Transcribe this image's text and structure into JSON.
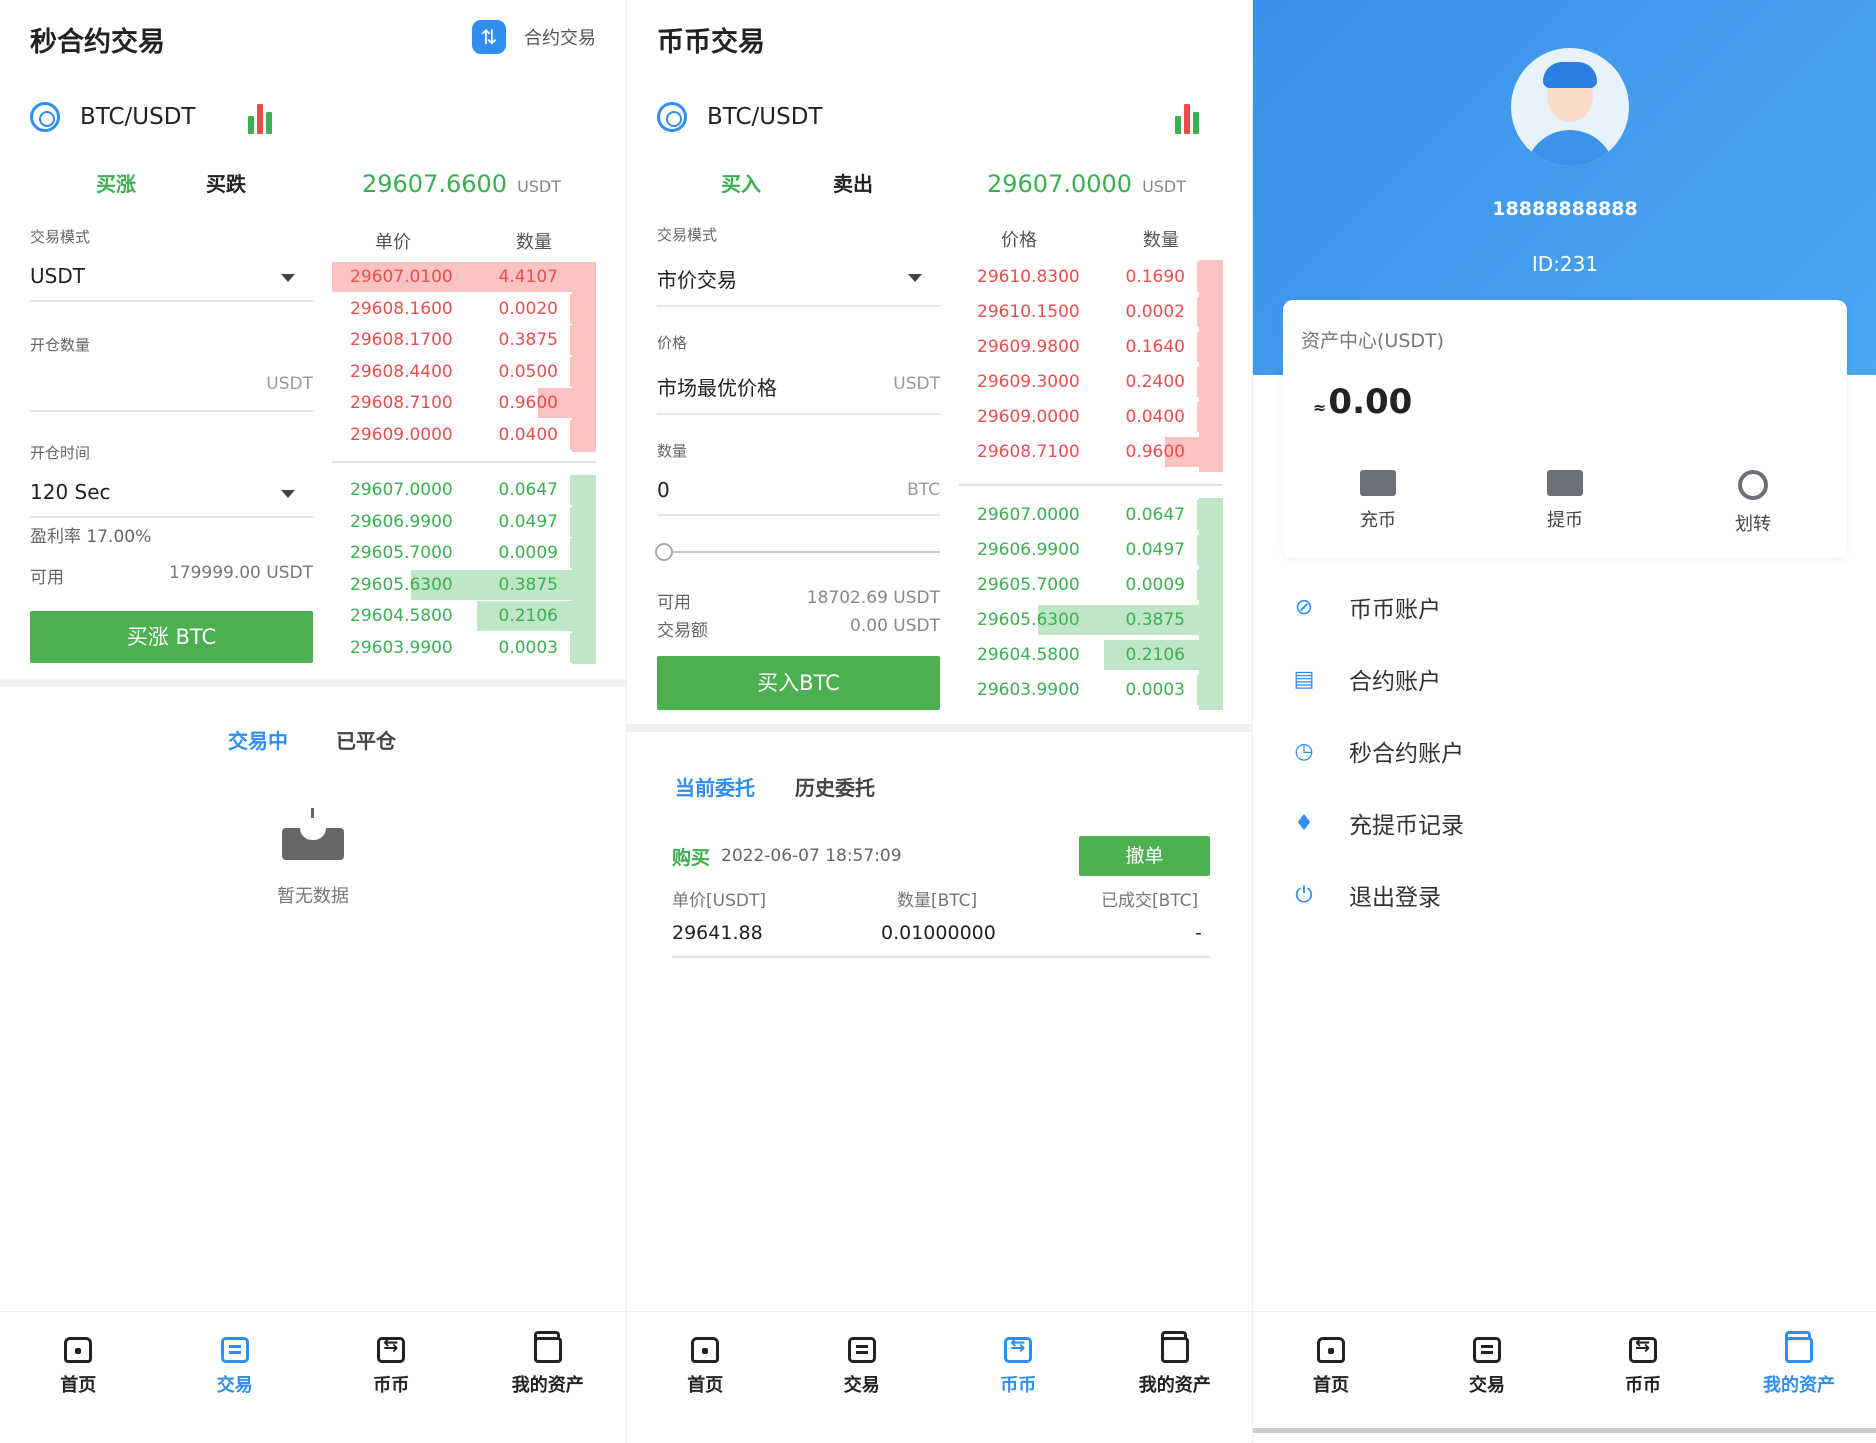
{
  "p1": {
    "title": "秒合约交易",
    "contract_link": "合约交易",
    "pair": "BTC/USDT",
    "tab_buy_up": "买涨",
    "tab_buy_down": "买跌",
    "last_price": "29607.6600",
    "last_price_unit": "USDT",
    "mode_label": "交易模式",
    "mode_value": "USDT",
    "qty_label": "开仓数量",
    "qty_unit": "USDT",
    "time_label": "开仓时间",
    "time_value": "120 Sec",
    "profit_rate": "盈利率 17.00%",
    "avail_label": "可用",
    "avail_value": "179999.00",
    "avail_unit": "USDT",
    "submit": "买涨 BTC",
    "ob_head_price": "单价",
    "ob_head_qty": "数量",
    "sells": [
      {
        "p": "29607.0100",
        "q": "4.4107",
        "fill": 1.0
      },
      {
        "p": "29608.1600",
        "q": "0.0020",
        "fill": 0.1
      },
      {
        "p": "29608.1700",
        "q": "0.3875",
        "fill": 0.1
      },
      {
        "p": "29608.4400",
        "q": "0.0500",
        "fill": 0.1
      },
      {
        "p": "29608.7100",
        "q": "0.9600",
        "fill": 0.22
      },
      {
        "p": "29609.0000",
        "q": "0.0400",
        "fill": 0.1
      }
    ],
    "buys": [
      {
        "p": "29607.0000",
        "q": "0.0647",
        "fill": 0.1
      },
      {
        "p": "29606.9900",
        "q": "0.0497",
        "fill": 0.1
      },
      {
        "p": "29605.7000",
        "q": "0.0009",
        "fill": 0.1
      },
      {
        "p": "29605.6300",
        "q": "0.3875",
        "fill": 0.7
      },
      {
        "p": "29604.5800",
        "q": "0.2106",
        "fill": 0.45
      },
      {
        "p": "29603.9900",
        "q": "0.0003",
        "fill": 0.1
      }
    ],
    "tab_trading": "交易中",
    "tab_closed": "已平仓",
    "empty": "暂无数据"
  },
  "p2": {
    "title": "币币交易",
    "pair": "BTC/USDT",
    "tab_buy": "买入",
    "tab_sell": "卖出",
    "last_price": "29607.0000",
    "last_price_unit": "USDT",
    "mode_label": "交易模式",
    "mode_value": "市价交易",
    "price_label": "价格",
    "price_value": "市场最优价格",
    "price_unit": "USDT",
    "qty_label": "数量",
    "qty_value": "0",
    "qty_unit": "BTC",
    "avail_label": "可用",
    "avail_value": "18702.69 USDT",
    "amount_label": "交易额",
    "amount_value": "0.00 USDT",
    "submit": "买入BTC",
    "ob_head_price": "价格",
    "ob_head_qty": "数量",
    "sells": [
      {
        "p": "29610.8300",
        "q": "0.1690",
        "fill": 0.1
      },
      {
        "p": "29610.1500",
        "q": "0.0002",
        "fill": 0.1
      },
      {
        "p": "29609.9800",
        "q": "0.1640",
        "fill": 0.1
      },
      {
        "p": "29609.3000",
        "q": "0.2400",
        "fill": 0.1
      },
      {
        "p": "29609.0000",
        "q": "0.0400",
        "fill": 0.1
      },
      {
        "p": "29608.7100",
        "q": "0.9600",
        "fill": 0.22
      }
    ],
    "buys": [
      {
        "p": "29607.0000",
        "q": "0.0647",
        "fill": 0.1
      },
      {
        "p": "29606.9900",
        "q": "0.0497",
        "fill": 0.1
      },
      {
        "p": "29605.7000",
        "q": "0.0009",
        "fill": 0.1
      },
      {
        "p": "29605.6300",
        "q": "0.3875",
        "fill": 0.7
      },
      {
        "p": "29604.5800",
        "q": "0.2106",
        "fill": 0.45
      },
      {
        "p": "29603.9900",
        "q": "0.0003",
        "fill": 0.1
      }
    ],
    "tab_current": "当前委托",
    "tab_history": "历史委托",
    "order": {
      "type": "购买",
      "time": "2022-06-07 18:57:09",
      "cancel": "撤单",
      "h_price": "单价[USDT]",
      "h_qty": "数量[BTC]",
      "h_filled": "已成交[BTC]",
      "price": "29641.88",
      "qty": "0.01000000",
      "filled": "-"
    }
  },
  "p3": {
    "phone": "18888888888",
    "uid": "ID:231",
    "asset_label": "资产中心(USDT)",
    "approx": "≈",
    "balance": "0.00",
    "deposit": "充币",
    "withdraw": "提币",
    "transfer": "划转",
    "menu": [
      "币币账户",
      "合约账户",
      "秒合约账户",
      "充提币记录",
      "退出登录"
    ]
  },
  "nav": {
    "home": "首页",
    "trade": "交易",
    "coin": "币币",
    "assets": "我的资产"
  },
  "colors": {
    "accent": "#2f8ef0",
    "green": "#3caf50",
    "red": "#e84e4e"
  }
}
